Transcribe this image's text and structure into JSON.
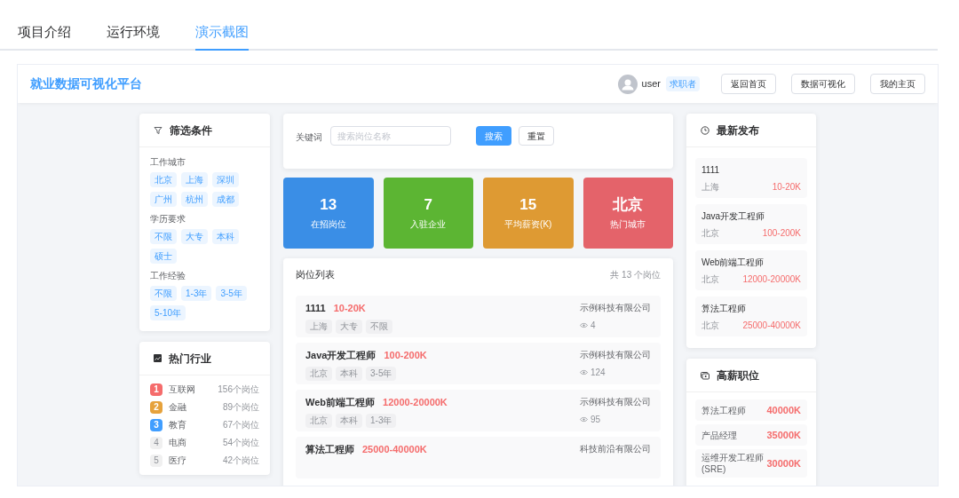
{
  "tabs": [
    {
      "label": "项目介绍",
      "selected": false
    },
    {
      "label": "运行环境",
      "selected": false
    },
    {
      "label": "演示截图",
      "selected": true
    }
  ],
  "header": {
    "title": "就业数据可视化平台",
    "user": "user",
    "role": "求职者",
    "buttons": [
      "返回首页",
      "数据可视化",
      "我的主页"
    ]
  },
  "filter": {
    "title": "筛选条件",
    "groups": [
      {
        "label": "工作城市",
        "tags": [
          "北京",
          "上海",
          "深圳",
          "广州",
          "杭州",
          "成都"
        ]
      },
      {
        "label": "学历要求",
        "tags": [
          "不限",
          "大专",
          "本科",
          "硕士"
        ]
      },
      {
        "label": "工作经验",
        "tags": [
          "不限",
          "1-3年",
          "3-5年",
          "5-10年"
        ]
      }
    ]
  },
  "industries": {
    "title": "热门行业",
    "items": [
      {
        "rank": "1",
        "name": "互联网",
        "count": "156个岗位",
        "kind": "top",
        "color": "#f56c6c"
      },
      {
        "rank": "2",
        "name": "金融",
        "count": "89个岗位",
        "kind": "top",
        "color": "#e6a23c"
      },
      {
        "rank": "3",
        "name": "教育",
        "count": "67个岗位",
        "kind": "top",
        "color": "#409eff"
      },
      {
        "rank": "4",
        "name": "电商",
        "count": "54个岗位",
        "kind": "plain"
      },
      {
        "rank": "5",
        "name": "医疗",
        "count": "42个岗位",
        "kind": "plain"
      }
    ]
  },
  "search": {
    "label": "关键词",
    "placeholder": "搜索岗位名称",
    "buttons": [
      "搜索",
      "重置"
    ]
  },
  "stats": [
    {
      "value": "13",
      "label": "在招岗位",
      "color": "#3a8ee6"
    },
    {
      "value": "7",
      "label": "入驻企业",
      "color": "#5cb533"
    },
    {
      "value": "15",
      "label": "平均薪资(K)",
      "color": "#de9a33"
    },
    {
      "value": "北京",
      "label": "热门城市",
      "color": "#e4636a"
    }
  ],
  "jobs": {
    "title": "岗位列表",
    "total": "共 13 个岗位",
    "items": [
      {
        "title": "1111",
        "salary": "10-20K",
        "tags": [
          "上海",
          "大专",
          "不限"
        ],
        "company": "示例科技有限公司",
        "views": "4"
      },
      {
        "title": "Java开发工程师",
        "salary": "100-200K",
        "tags": [
          "北京",
          "本科",
          "3-5年"
        ],
        "company": "示例科技有限公司",
        "views": "124"
      },
      {
        "title": "Web前端工程师",
        "salary": "12000-20000K",
        "tags": [
          "北京",
          "本科",
          "1-3年"
        ],
        "company": "示例科技有限公司",
        "views": "95"
      },
      {
        "title": "算法工程师",
        "salary": "25000-40000K",
        "company": "科技前沿有限公司"
      }
    ]
  },
  "latest": {
    "title": "最新发布",
    "items": [
      {
        "title": "1111",
        "city": "上海",
        "salary": "10-20K"
      },
      {
        "title": "Java开发工程师",
        "city": "北京",
        "salary": "100-200K"
      },
      {
        "title": "Web前端工程师",
        "city": "北京",
        "salary": "12000-20000K"
      },
      {
        "title": "算法工程师",
        "city": "北京",
        "salary": "25000-40000K"
      }
    ]
  },
  "high_salary": {
    "title": "高薪职位",
    "items": [
      {
        "title": "算法工程师",
        "salary": "40000K"
      },
      {
        "title": "产品经理",
        "salary": "35000K"
      },
      {
        "title": "运维开发工程师(SRE)",
        "salary": "30000K"
      }
    ]
  }
}
